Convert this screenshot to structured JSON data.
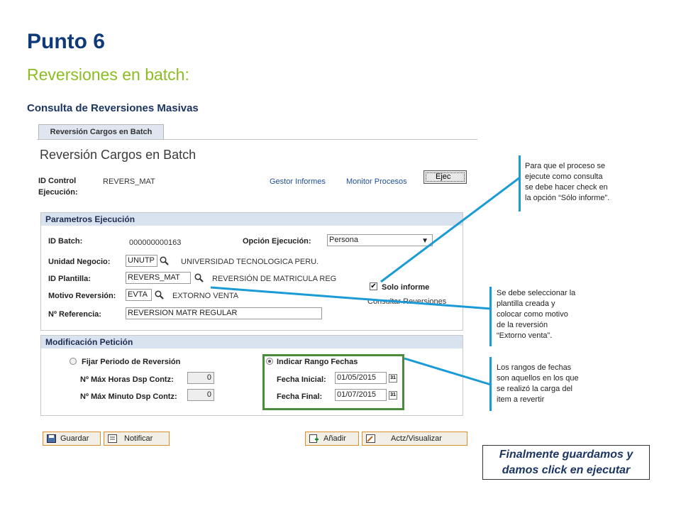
{
  "slide": {
    "title": "Punto 6",
    "subtitle": "Reversiones en batch:",
    "section": "Consulta de Reversiones Masivas"
  },
  "screen": {
    "tab_label": "Reversión Cargos en Batch",
    "page_title": "Reversión Cargos en Batch",
    "id_control_label_1": "ID Control",
    "id_control_label_2": "Ejecución:",
    "id_control_value": "REVERS_MAT",
    "link_gestor": "Gestor Informes",
    "link_monitor": "Monitor Procesos",
    "btn_ejec": "Ejec"
  },
  "params": {
    "header": "Parametros Ejecución",
    "id_batch_label": "ID Batch:",
    "id_batch_value": "000000000163",
    "opcion_label": "Opción Ejecución:",
    "opcion_value": "Persona",
    "unidad_label": "Unidad Negocio:",
    "unidad_value": "UNUTP",
    "unidad_desc": "UNIVERSIDAD TECNOLOGICA PERU.",
    "plantilla_label": "ID Plantilla:",
    "plantilla_value": "REVERS_MAT",
    "plantilla_desc": "REVERSIÓN DE MATRICULA REG",
    "motivo_label": "Motivo Reversión:",
    "motivo_value": "EVTA",
    "motivo_desc": "EXTORNO VENTA",
    "solo_informe_label": "Solo informe",
    "solo_informe_checked": true,
    "consultar_link": "Consultar Reversiones",
    "referencia_label": "Nº Referencia:",
    "referencia_value": "REVERSION MATR REGULAR"
  },
  "modif": {
    "header": "Modificación Petición",
    "fijar_label": "Fijar Periodo de Reversión",
    "horas_label": "Nº Máx Horas Dsp Contz:",
    "horas_value": "0",
    "minuto_label": "Nº Máx Minuto Dsp Contz:",
    "minuto_value": "0",
    "rango_label": "Indicar Rango Fechas",
    "fecha_ini_label": "Fecha Inicial:",
    "fecha_ini_value": "01/05/2015",
    "fecha_fin_label": "Fecha Final:",
    "fecha_fin_value": "01/07/2015",
    "cal_glyph": "31"
  },
  "toolbar": {
    "guardar": "Guardar",
    "notificar": "Notificar",
    "anadir": "Añadir",
    "actualizar": "Actz/Visualizar"
  },
  "annotations": {
    "note1": [
      "Para que el proceso se",
      "ejecute como consulta",
      "se debe hacer check en",
      "la opción “Sólo informe”."
    ],
    "note2": [
      "Se debe seleccionar la",
      "plantilla creada y",
      "colocar como motivo",
      "de la reversión",
      "“Extorno venta”."
    ],
    "note3": [
      "Los rangos de fechas",
      "son aquellos en los que",
      "se realizó la carga del",
      "item a revertir"
    ],
    "final_line1": "Finalmente guardamos y",
    "final_line2": "damos click en ejecutar"
  },
  "colors": {
    "title": "#0f3a7a",
    "subtitle": "#8cbd23",
    "annotation_line": "#1a9ad6",
    "highlight_box": "#4a8c3b"
  }
}
